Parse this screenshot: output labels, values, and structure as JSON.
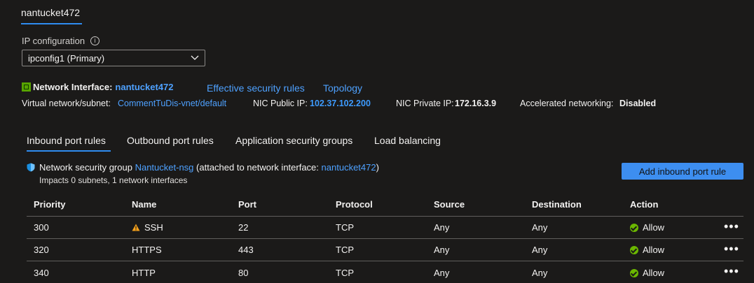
{
  "nic_tab": "nantucket472",
  "ip_configuration": {
    "label": "IP configuration",
    "info_icon": "info-icon",
    "selected": "ipconfig1 (Primary)"
  },
  "network_interface": {
    "title": "Network Interface:",
    "name": "nantucket472",
    "links": [
      "Effective security rules",
      "Topology"
    ],
    "vnet_label": "Virtual network/subnet:",
    "vnet_value": "CommentTuDis-vnet/default",
    "public_ip_label": "NIC Public IP:",
    "public_ip": "102.37.102.200",
    "private_ip_label": "NIC Private IP:",
    "private_ip": "172.16.3.9",
    "accel_label": "Accelerated networking:",
    "accel_value": "Disabled"
  },
  "tabs": [
    "Inbound port rules",
    "Outbound port rules",
    "Application security groups",
    "Load balancing"
  ],
  "nsg": {
    "prefix": "Network security group",
    "name": "Nantucket-nsg",
    "middle": "(attached to network interface:",
    "nic": "nantucket472",
    "suffix": ")",
    "impacts": "Impacts 0 subnets, 1 network interfaces",
    "add_button": "Add inbound port rule"
  },
  "table": {
    "columns": [
      "Priority",
      "Name",
      "Port",
      "Protocol",
      "Source",
      "Destination",
      "Action"
    ],
    "rows": [
      {
        "priority": "300",
        "name": "SSH",
        "warning": true,
        "port": "22",
        "protocol": "TCP",
        "source": "Any",
        "destination": "Any",
        "action": "Allow"
      },
      {
        "priority": "320",
        "name": "HTTPS",
        "warning": false,
        "port": "443",
        "protocol": "TCP",
        "source": "Any",
        "destination": "Any",
        "action": "Allow"
      },
      {
        "priority": "340",
        "name": "HTTP",
        "warning": false,
        "port": "80",
        "protocol": "TCP",
        "source": "Any",
        "destination": "Any",
        "action": "Allow"
      }
    ],
    "more_label": "•••"
  },
  "colors": {
    "accent": "#2f8cf0",
    "link": "#4ea1ff",
    "allow": "#6bb700",
    "warning": "#f7a21b"
  }
}
